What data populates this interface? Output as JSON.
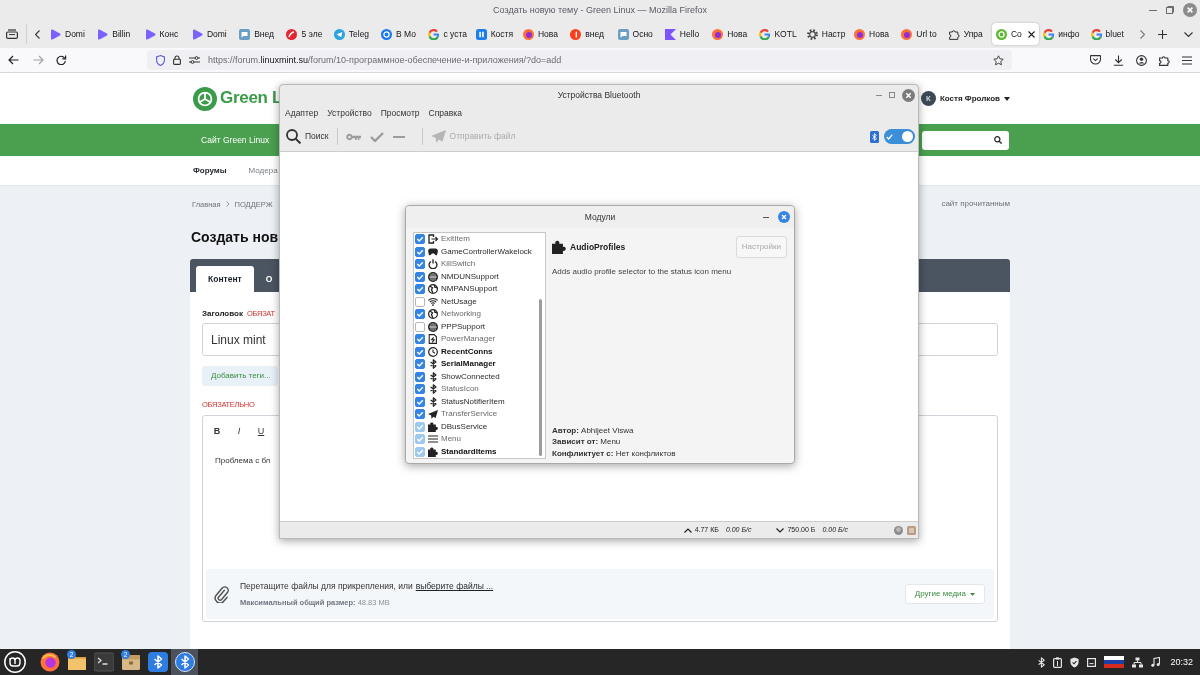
{
  "browser": {
    "title": "Создать новую тему - Green Linux — Mozilla Firefox",
    "tabs": [
      {
        "label": "Domi",
        "selected": false
      },
      {
        "label": "Billin",
        "selected": false
      },
      {
        "label": "Конс",
        "selected": false
      },
      {
        "label": "Domi",
        "selected": false
      },
      {
        "label": "Внед",
        "selected": false
      },
      {
        "label": "5 эле",
        "selected": false
      },
      {
        "label": "Teleg",
        "selected": false
      },
      {
        "label": "В Мо",
        "selected": false
      },
      {
        "label": "с уста",
        "selected": false
      },
      {
        "label": "Костя",
        "selected": false
      },
      {
        "label": "Нова",
        "selected": false
      },
      {
        "label": "внед",
        "selected": false
      },
      {
        "label": "Осно",
        "selected": false
      },
      {
        "label": "Hello",
        "selected": false
      },
      {
        "label": "Нова",
        "selected": false
      },
      {
        "label": "KOTL",
        "selected": false
      },
      {
        "label": "Настр",
        "selected": false
      },
      {
        "label": "Нова",
        "selected": false
      },
      {
        "label": "Url to",
        "selected": false
      },
      {
        "label": "Упра",
        "selected": false
      },
      {
        "label": "Co",
        "selected": true
      },
      {
        "label": "инфо",
        "selected": false
      },
      {
        "label": "bluet",
        "selected": false
      }
    ],
    "nav_buttons": [
      {
        "disabled": false
      },
      {
        "disabled": true
      },
      {
        "disabled": false
      }
    ],
    "url_parts": [
      {
        "text": "https://forum.",
        "kind": "dim"
      },
      {
        "text": "linuxmint.su",
        "kind": "host"
      },
      {
        "text": "/forum/10-программное-обеспечение-и-приложения/?do=add",
        "kind": "dim"
      }
    ]
  },
  "forum": {
    "logo_text": "Green L",
    "user": {
      "initial": "К",
      "name": "Костя Фролков"
    },
    "nav_link": "Сайт Green Linux",
    "subnav": [
      {
        "label": "Форумы",
        "selected": true
      },
      {
        "label": "Модера",
        "selected": false
      }
    ],
    "breadcrumbs": [
      "Главная",
      "ПОДДЕРЖ"
    ],
    "mark_read": "сайт прочитанным",
    "page_title": "Создать нов",
    "form_tabs": [
      {
        "label": "Контент",
        "selected": true
      },
      {
        "label": "О",
        "selected": false
      }
    ],
    "title_field": {
      "label": "Заголовок",
      "required": "ОБЯЗАТ",
      "value": "Linux mint"
    },
    "tags_button": "Добавить теги...",
    "editor": {
      "required": "ОБЯЗАТЕЛЬНО",
      "tools": [
        "B",
        "I",
        "U"
      ],
      "text": "Проблема с бл"
    },
    "attachments": {
      "hint": "Перетащите файлы для прикрепления, или",
      "link": "выберите файлы ...",
      "limit": "**Максимальный общий размер:** 48.83 MB",
      "media_button": "Другие медиа"
    }
  },
  "bluetooth_window": {
    "title": "Устройства Bluetooth",
    "menu": [
      "Адаптер",
      "Устройство",
      "Просмотр",
      "Справка"
    ],
    "toolbar": {
      "search": {
        "label": "Поиск",
        "disabled": false
      },
      "device_actions": [
        {
          "disabled": true
        },
        {
          "disabled": true
        },
        {
          "disabled": true
        }
      ],
      "send": {
        "label": "Отправить файл",
        "disabled": true
      }
    },
    "power": {
      "on": true
    },
    "status": {
      "sent": "4.77 КБ",
      "sent_rate": "0.00 Б/с",
      "received": "750.00 Б",
      "received_rate": "0.00 Б/с"
    }
  },
  "modules_dialog": {
    "title": "Модули",
    "plugins": [
      {
        "name": "ExitItem",
        "checked": true,
        "disabled": false,
        "dimmed": true,
        "emphasized": false,
        "selected": false
      },
      {
        "name": "GameControllerWakelock",
        "checked": true,
        "disabled": false,
        "dimmed": false,
        "emphasized": false,
        "selected": false
      },
      {
        "name": "KillSwitch",
        "checked": true,
        "disabled": false,
        "dimmed": true,
        "emphasized": false,
        "selected": false
      },
      {
        "name": "NMDUNSupport",
        "checked": true,
        "disabled": false,
        "dimmed": false,
        "emphasized": false,
        "selected": false
      },
      {
        "name": "NMPANSupport",
        "checked": true,
        "disabled": false,
        "dimmed": false,
        "emphasized": false,
        "selected": false
      },
      {
        "name": "NetUsage",
        "checked": false,
        "disabled": false,
        "dimmed": false,
        "emphasized": false,
        "selected": false
      },
      {
        "name": "Networking",
        "checked": true,
        "disabled": false,
        "dimmed": true,
        "emphasized": false,
        "selected": false
      },
      {
        "name": "PPPSupport",
        "checked": false,
        "disabled": false,
        "dimmed": false,
        "emphasized": false,
        "selected": false
      },
      {
        "name": "PowerManager",
        "checked": true,
        "disabled": false,
        "dimmed": true,
        "emphasized": false,
        "selected": false
      },
      {
        "name": "RecentConns",
        "checked": true,
        "disabled": false,
        "dimmed": false,
        "emphasized": true,
        "selected": false
      },
      {
        "name": "SerialManager",
        "checked": true,
        "disabled": false,
        "dimmed": false,
        "emphasized": true,
        "selected": false
      },
      {
        "name": "ShowConnected",
        "checked": true,
        "disabled": false,
        "dimmed": false,
        "emphasized": false,
        "selected": false
      },
      {
        "name": "StatusIcon",
        "checked": true,
        "disabled": false,
        "dimmed": true,
        "emphasized": false,
        "selected": false
      },
      {
        "name": "StatusNotifierItem",
        "checked": true,
        "disabled": false,
        "dimmed": false,
        "emphasized": false,
        "selected": false
      },
      {
        "name": "TransferService",
        "checked": true,
        "disabled": false,
        "dimmed": true,
        "emphasized": false,
        "selected": false
      },
      {
        "name": "DBusService",
        "checked": true,
        "disabled": true,
        "dimmed": false,
        "emphasized": false,
        "selected": false
      },
      {
        "name": "Menu",
        "checked": true,
        "disabled": true,
        "dimmed": true,
        "emphasized": false,
        "selected": false
      },
      {
        "name": "StandardItems",
        "checked": true,
        "disabled": true,
        "dimmed": false,
        "emphasized": true,
        "selected": false
      }
    ],
    "details": {
      "name": "AudioProfiles",
      "settings_button": {
        "label": "Настройки",
        "disabled": true
      },
      "description": "Adds audio profile selector to the status icon menu",
      "info_lines": [
        "**Автор:** Abhijeet Viswa",
        "**Зависит от:** Menu",
        "**Конфликтует с:** Нет конфликтов"
      ]
    }
  },
  "taskbar": {
    "apps": [
      {
        "selected": false
      },
      {
        "selected": false,
        "badge": "2"
      },
      {
        "selected": false
      },
      {
        "selected": false,
        "badge": "2"
      },
      {
        "selected": false
      },
      {
        "selected": true
      }
    ],
    "clock": "20:32"
  }
}
